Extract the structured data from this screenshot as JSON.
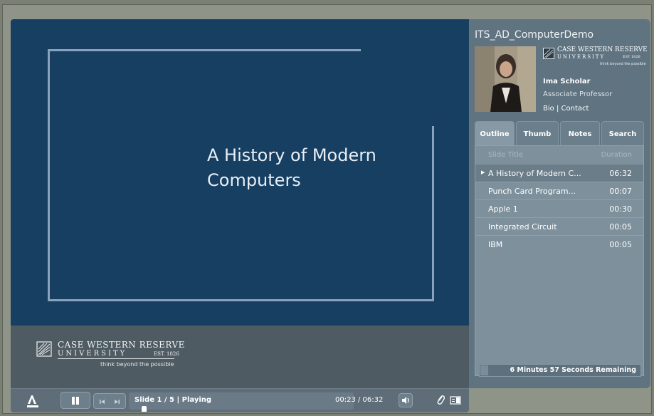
{
  "presentation": {
    "title": "ITS_AD_ComputerDemo"
  },
  "slide": {
    "title_line1": "A History of Modern",
    "title_line2": "Computers",
    "background_color": "#163f62",
    "logo": {
      "name": "CASE WESTERN RESERVE",
      "university": "UNIVERSITY",
      "est": "EST. 1826",
      "tagline": "think beyond the possible"
    }
  },
  "presenter": {
    "name": "Ima Scholar",
    "role": "Associate Professor",
    "bio_label": "Bio",
    "separator": "|",
    "contact_label": "Contact",
    "logo_name": "CASE WESTERN RESERVE",
    "logo_university": "UNIVERSITY",
    "logo_est": "EST 1826",
    "logo_tagline": "think beyond the possible"
  },
  "tabs": [
    {
      "label": "Outline",
      "active": true
    },
    {
      "label": "Thumb",
      "active": false
    },
    {
      "label": "Notes",
      "active": false
    },
    {
      "label": "Search",
      "active": false
    }
  ],
  "outline": {
    "header_title": "Slide Title",
    "header_duration": "Duration",
    "rows": [
      {
        "title": "A History of Modern C...",
        "duration": "06:32",
        "active": true
      },
      {
        "title": "Punch Card Program...",
        "duration": "00:07",
        "active": false
      },
      {
        "title": "Apple 1",
        "duration": "00:30",
        "active": false
      },
      {
        "title": "Integrated Circuit",
        "duration": "00:05",
        "active": false
      },
      {
        "title": "IBM",
        "duration": "00:05",
        "active": false
      }
    ],
    "remaining_text": "6 Minutes 57 Seconds Remaining",
    "remaining_progress": 0.05
  },
  "controls": {
    "adobe_label": "Adobe",
    "status": "Slide 1 / 5 | Playing",
    "time": "00:23 / 06:32",
    "progress_fraction": 0.06
  },
  "icons": {
    "pause": "pause-icon",
    "prev": "previous-slide-icon",
    "next": "next-slide-icon",
    "volume": "volume-icon",
    "attachment": "paperclip-icon",
    "sidebar": "sidebar-toggle-icon"
  }
}
